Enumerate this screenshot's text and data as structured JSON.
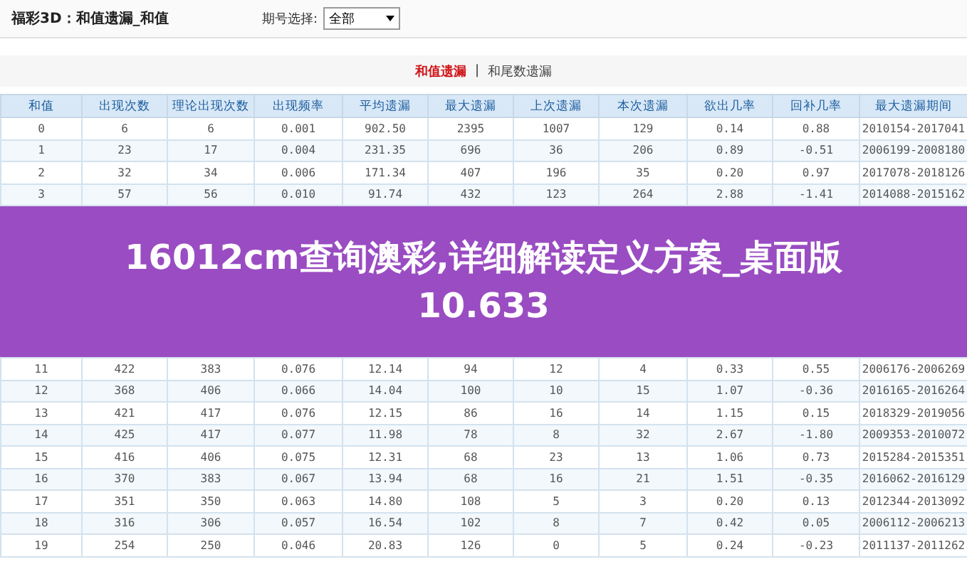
{
  "header": {
    "title": "福彩3D：和值遗漏_和值",
    "period_label": "期号选择:",
    "period_select": "全部"
  },
  "tabs": [
    {
      "label": "和值遗漏",
      "selected": true
    },
    {
      "label": "和尾数遗漏",
      "selected": false
    }
  ],
  "tab_separator": "|",
  "table": {
    "columns": [
      "和值",
      "出现次数",
      "理论出现次数",
      "出现频率",
      "平均遗漏",
      "最大遗漏",
      "上次遗漏",
      "本次遗漏",
      "欲出几率",
      "回补几率",
      "最大遗漏期间"
    ],
    "rows": [
      [
        "0",
        "6",
        "6",
        "0.001",
        "902.50",
        "2395",
        "1007",
        "129",
        "0.14",
        "0.88",
        "2010154-2017041"
      ],
      [
        "1",
        "23",
        "17",
        "0.004",
        "231.35",
        "696",
        "36",
        "206",
        "0.89",
        "-0.51",
        "2006199-2008180"
      ],
      [
        "2",
        "32",
        "34",
        "0.006",
        "171.34",
        "407",
        "196",
        "35",
        "0.20",
        "0.97",
        "2017078-2018126"
      ],
      [
        "3",
        "57",
        "56",
        "0.010",
        "91.74",
        "432",
        "123",
        "264",
        "2.88",
        "-1.41",
        "2014088-2015162"
      ],
      [
        "11",
        "422",
        "383",
        "0.076",
        "12.14",
        "94",
        "12",
        "4",
        "0.33",
        "0.55",
        "2006176-2006269"
      ],
      [
        "12",
        "368",
        "406",
        "0.066",
        "14.04",
        "100",
        "10",
        "15",
        "1.07",
        "-0.36",
        "2016165-2016264"
      ],
      [
        "13",
        "421",
        "417",
        "0.076",
        "12.15",
        "86",
        "16",
        "14",
        "1.15",
        "0.15",
        "2018329-2019056"
      ],
      [
        "14",
        "425",
        "417",
        "0.077",
        "11.98",
        "78",
        "8",
        "32",
        "2.67",
        "-1.80",
        "2009353-2010072"
      ],
      [
        "15",
        "416",
        "406",
        "0.075",
        "12.31",
        "68",
        "23",
        "13",
        "1.06",
        "0.73",
        "2015284-2015351"
      ],
      [
        "16",
        "370",
        "383",
        "0.067",
        "13.94",
        "68",
        "16",
        "21",
        "1.51",
        "-0.35",
        "2016062-2016129"
      ],
      [
        "17",
        "351",
        "350",
        "0.063",
        "14.80",
        "108",
        "5",
        "3",
        "0.20",
        "0.13",
        "2012344-2013092"
      ],
      [
        "18",
        "316",
        "306",
        "0.057",
        "16.54",
        "102",
        "8",
        "7",
        "0.42",
        "0.05",
        "2006112-2006213"
      ],
      [
        "19",
        "254",
        "250",
        "0.046",
        "20.83",
        "126",
        "0",
        "5",
        "0.24",
        "-0.23",
        "2011137-2011262"
      ]
    ]
  },
  "banner": {
    "text": "16012cm查询澳彩,详细解读定义方案_桌面版10.633"
  }
}
